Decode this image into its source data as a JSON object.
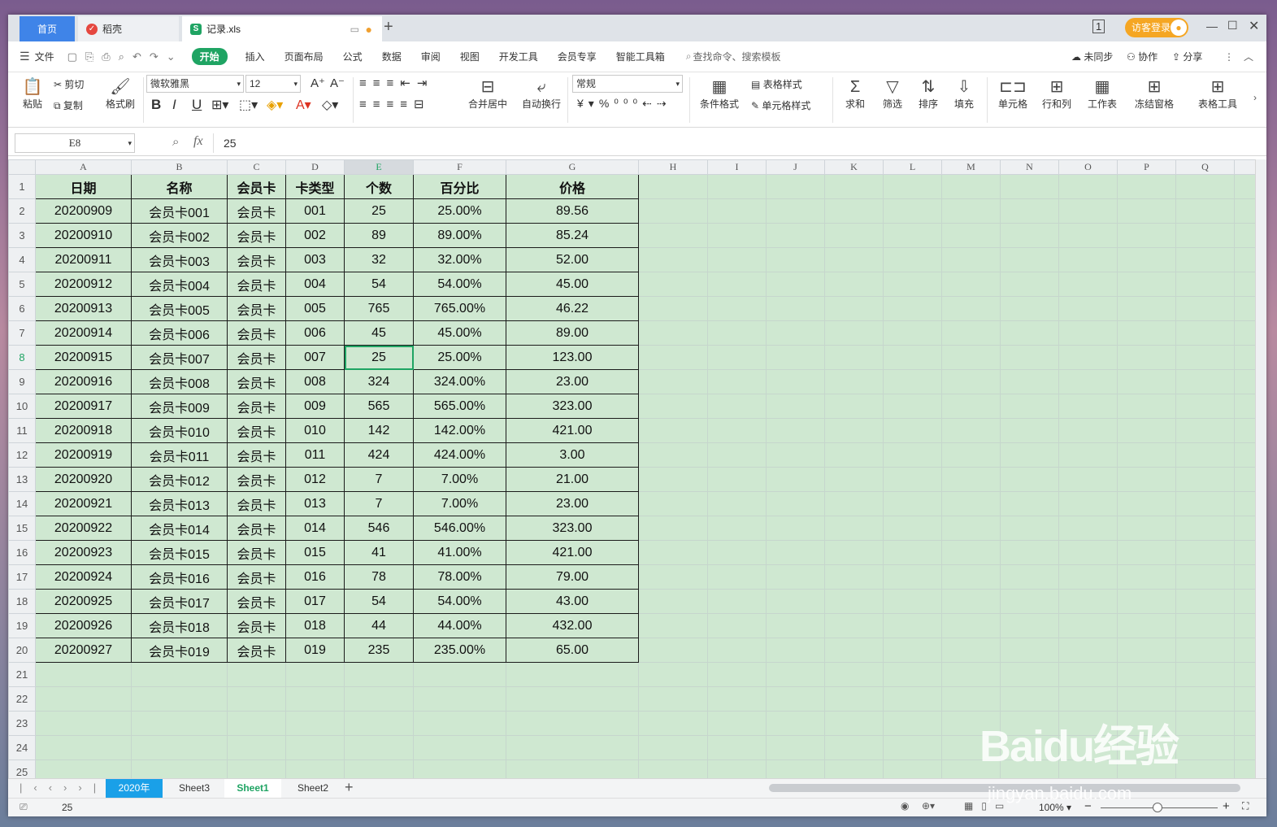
{
  "titlebar": {
    "tabs": [
      {
        "label": "首页"
      },
      {
        "label": "稻壳"
      },
      {
        "label": "记录.xls"
      }
    ],
    "login_label": "访客登录"
  },
  "menu": {
    "file_label": "文件",
    "items": [
      "开始",
      "插入",
      "页面布局",
      "公式",
      "数据",
      "审阅",
      "视图",
      "开发工具",
      "会员专享",
      "智能工具箱"
    ],
    "search_placeholder": "查找命令、搜索模板",
    "right": [
      "未同步",
      "协作",
      "分享"
    ]
  },
  "ribbon": {
    "paste": "粘贴",
    "cut": "剪切",
    "copy": "复制",
    "format_painter": "格式刷",
    "font_name": "微软雅黑",
    "font_size": "12",
    "merge_center": "合并居中",
    "wrap_text": "自动换行",
    "number_format": "常规",
    "cond_format": "条件格式",
    "table_style": "表格样式",
    "cell_style": "单元格样式",
    "sum": "求和",
    "filter": "筛选",
    "sort": "排序",
    "fill": "填充",
    "cell": "单元格",
    "row_col": "行和列",
    "worksheet": "工作表",
    "freeze": "冻结窗格",
    "table_tools": "表格工具"
  },
  "formula_bar": {
    "name_box": "E8",
    "fx": "fx",
    "value": "25"
  },
  "sheet": {
    "columns": [
      "A",
      "B",
      "C",
      "D",
      "E",
      "F",
      "G",
      "H",
      "I",
      "J",
      "K",
      "L",
      "M",
      "N",
      "O",
      "P",
      "Q"
    ],
    "headers": [
      "日期",
      "名称",
      "会员卡",
      "卡类型",
      "个数",
      "百分比",
      "价格"
    ],
    "rows": [
      [
        "20200909",
        "会员卡001",
        "会员卡",
        "001",
        "25",
        "25.00%",
        "89.56"
      ],
      [
        "20200910",
        "会员卡002",
        "会员卡",
        "002",
        "89",
        "89.00%",
        "85.24"
      ],
      [
        "20200911",
        "会员卡003",
        "会员卡",
        "003",
        "32",
        "32.00%",
        "52.00"
      ],
      [
        "20200912",
        "会员卡004",
        "会员卡",
        "004",
        "54",
        "54.00%",
        "45.00"
      ],
      [
        "20200913",
        "会员卡005",
        "会员卡",
        "005",
        "765",
        "765.00%",
        "46.22"
      ],
      [
        "20200914",
        "会员卡006",
        "会员卡",
        "006",
        "45",
        "45.00%",
        "89.00"
      ],
      [
        "20200915",
        "会员卡007",
        "会员卡",
        "007",
        "25",
        "25.00%",
        "123.00"
      ],
      [
        "20200916",
        "会员卡008",
        "会员卡",
        "008",
        "324",
        "324.00%",
        "23.00"
      ],
      [
        "20200917",
        "会员卡009",
        "会员卡",
        "009",
        "565",
        "565.00%",
        "323.00"
      ],
      [
        "20200918",
        "会员卡010",
        "会员卡",
        "010",
        "142",
        "142.00%",
        "421.00"
      ],
      [
        "20200919",
        "会员卡011",
        "会员卡",
        "011",
        "424",
        "424.00%",
        "3.00"
      ],
      [
        "20200920",
        "会员卡012",
        "会员卡",
        "012",
        "7",
        "7.00%",
        "21.00"
      ],
      [
        "20200921",
        "会员卡013",
        "会员卡",
        "013",
        "7",
        "7.00%",
        "23.00"
      ],
      [
        "20200922",
        "会员卡014",
        "会员卡",
        "014",
        "546",
        "546.00%",
        "323.00"
      ],
      [
        "20200923",
        "会员卡015",
        "会员卡",
        "015",
        "41",
        "41.00%",
        "421.00"
      ],
      [
        "20200924",
        "会员卡016",
        "会员卡",
        "016",
        "78",
        "78.00%",
        "79.00"
      ],
      [
        "20200925",
        "会员卡017",
        "会员卡",
        "017",
        "54",
        "54.00%",
        "43.00"
      ],
      [
        "20200926",
        "会员卡018",
        "会员卡",
        "018",
        "44",
        "44.00%",
        "432.00"
      ],
      [
        "20200927",
        "会员卡019",
        "会员卡",
        "019",
        "235",
        "235.00%",
        "65.00"
      ]
    ],
    "empty_row_numbers": [
      "21",
      "22",
      "23",
      "24",
      "25"
    ],
    "selected_cell": "E8"
  },
  "sheet_tabs": [
    "2020年",
    "Sheet3",
    "Sheet1",
    "Sheet2"
  ],
  "active_sheet": "Sheet1",
  "status": {
    "cell_value": "25",
    "zoom": "100%"
  },
  "watermark": {
    "logo": "Baidu经验",
    "url": "jingyan.baidu.com"
  },
  "colors": {
    "accent": "#1fa463",
    "cell_fill": "#cfe8d1",
    "home_tab": "#3f84e8",
    "login": "#f5a623"
  }
}
